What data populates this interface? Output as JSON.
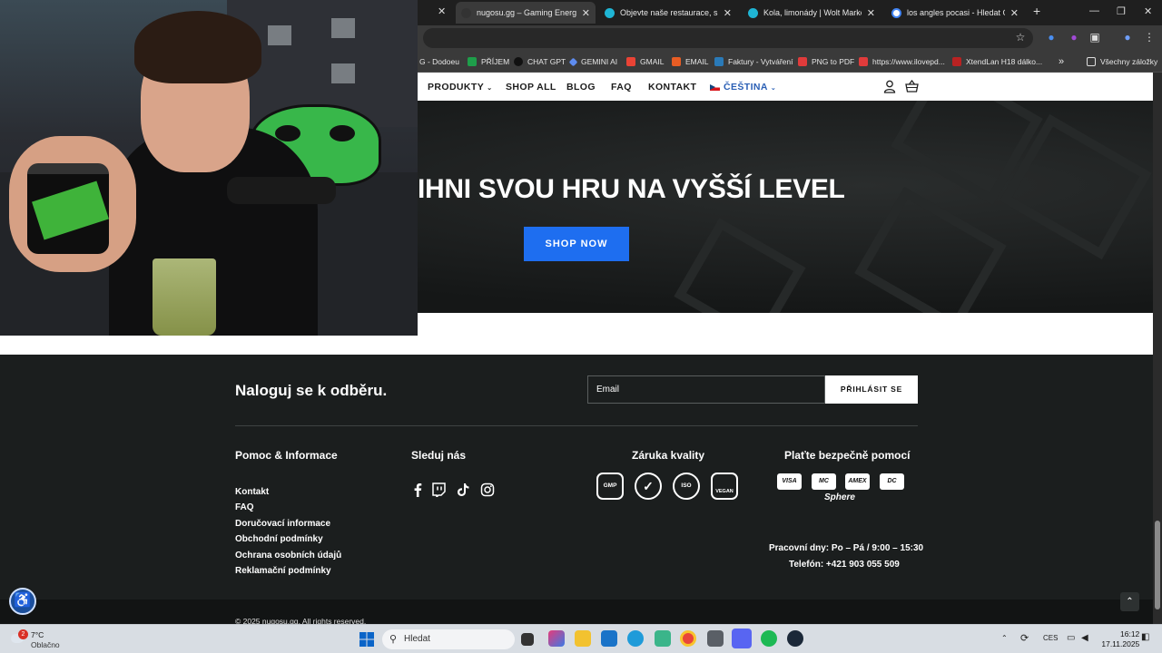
{
  "browser": {
    "tabs": [
      {
        "title": "nugosu.gg – Gaming Energy",
        "color": "#333333"
      },
      {
        "title": "Objevte naše restaurace, super",
        "color": "#1fb5d4"
      },
      {
        "title": "Kola, limonády | Wolt Market M",
        "color": "#1fb5d4"
      },
      {
        "title": "los angles pocasi - Hledat Goo",
        "color": "#ffffff"
      }
    ],
    "bookmarks": [
      {
        "label": "G - Dodoeu",
        "color": "#777777"
      },
      {
        "label": "PŘÍJEM",
        "color": "#1e9e4a"
      },
      {
        "label": "CHAT GPT",
        "color": "#111111"
      },
      {
        "label": "GEMINI AI",
        "color": "#5e8cf0"
      },
      {
        "label": "GMAIL",
        "color": "#ea4335"
      },
      {
        "label": "EMAIL",
        "color": "#e85d24"
      },
      {
        "label": "Faktury - Vytváření",
        "color": "#2a7ab8"
      },
      {
        "label": "PNG to PDF",
        "color": "#e03b3b"
      },
      {
        "label": "https://www.ilovepd...",
        "color": "#e03b3b"
      },
      {
        "label": "XtendLan H18 dálko...",
        "color": "#b92222"
      }
    ],
    "bookmarks_more": "»",
    "all_bookmarks": "Všechny záložky"
  },
  "nav": {
    "items": [
      "PRODUKTY",
      "SHOP ALL",
      "BLOG",
      "FAQ",
      "KONTAKT"
    ],
    "language": "ČEŠTINA"
  },
  "hero": {
    "title": "IHNI SVOU HRU NA VYŠŠÍ LEVEL",
    "button": "SHOP NOW"
  },
  "footer": {
    "newsletter_title": "Naloguj se k odběru.",
    "email_placeholder": "Email",
    "subscribe_button": "PŘIHLÁSIT SE",
    "help_heading": "Pomoc & Informace",
    "help_links": [
      "Kontakt",
      "FAQ",
      "Doručovací informace",
      "Obchodní podmínky",
      "Ochrana osobních údajů",
      "Reklamační podmínky"
    ],
    "follow_heading": "Sleduj nás",
    "quality_heading": "Záruka kvality",
    "quality_badges": [
      "GMP",
      "✓",
      "ISO",
      "VEGAN"
    ],
    "pay_heading": "Plaťte bezpečně pomocí",
    "pay_methods": [
      "VISA",
      "MC",
      "AMEX",
      "DC"
    ],
    "pay_extra": "Sphere",
    "hours": "Pracovní dny: Po – Pá / 9:00 – 15:30",
    "phone": "Telefón: +421 903 055 509",
    "copyright": "© 2025 nugosu.gg. All rights reserved."
  },
  "taskbar": {
    "weather_temp": "7°C",
    "weather_desc": "Oblačno",
    "weather_badge": "2",
    "search_placeholder": "Hledat",
    "lang": "CES",
    "time": "16:12",
    "date": "17.11.2025"
  }
}
